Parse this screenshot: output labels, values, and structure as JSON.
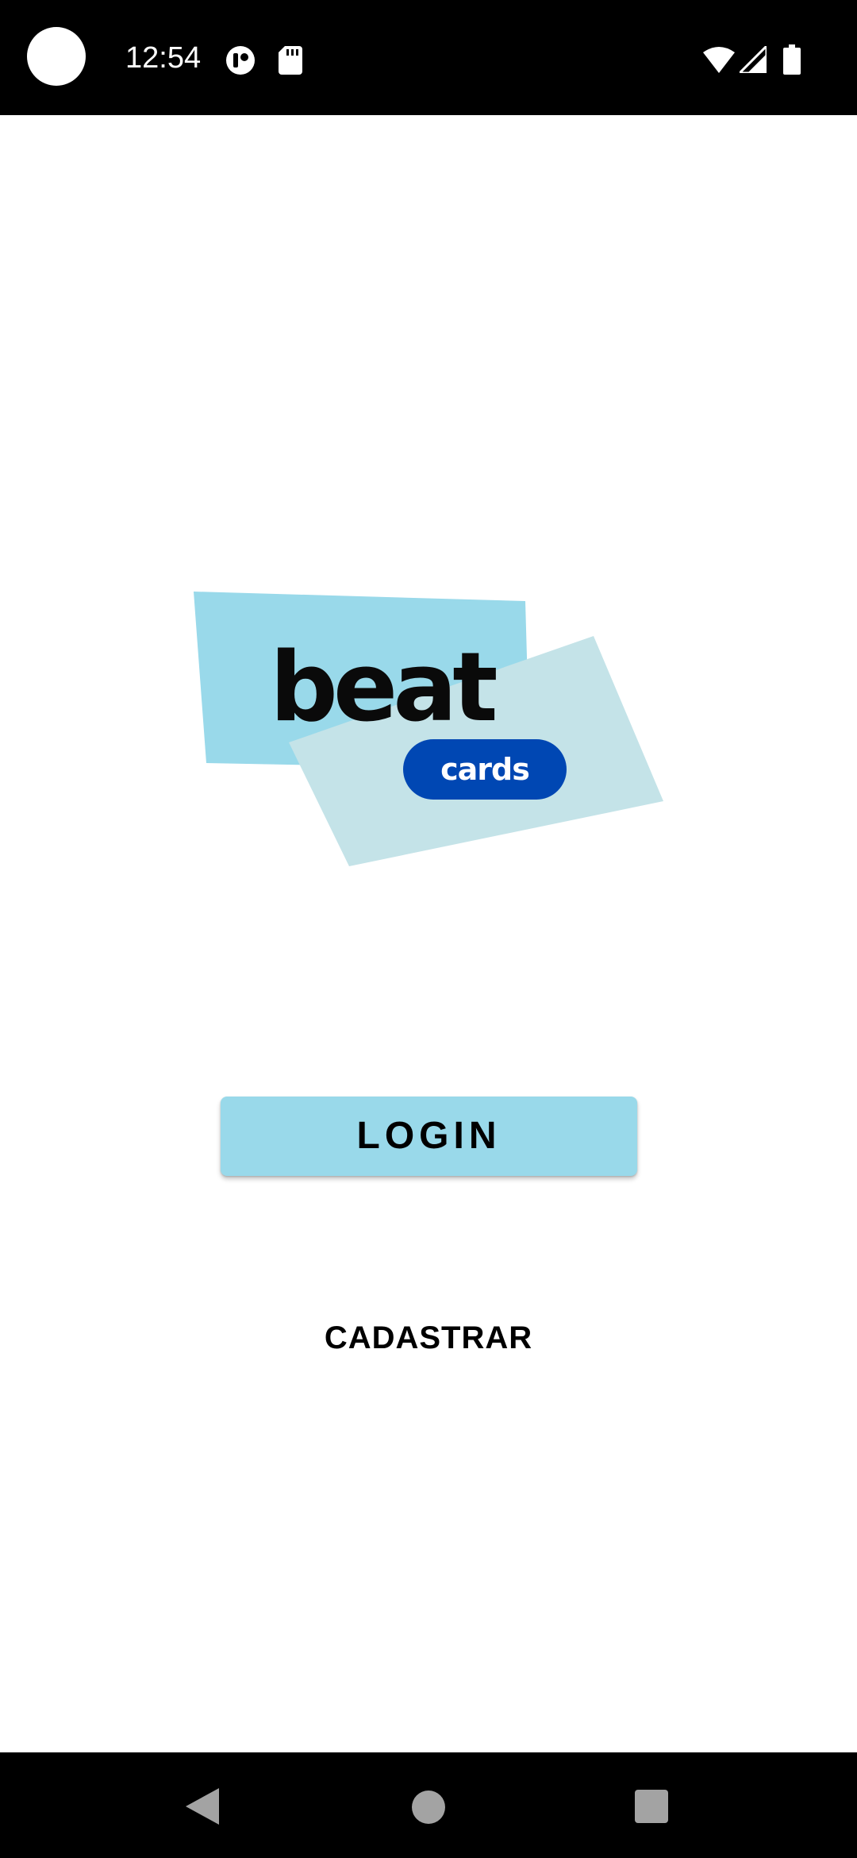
{
  "status_bar": {
    "time": "12:54",
    "icons": [
      "camera-cutout",
      "app-notification-icon",
      "sd-card-icon",
      "wifi-icon",
      "signal-icon",
      "battery-icon"
    ]
  },
  "logo": {
    "word": "beat",
    "pill": "cards",
    "colors": {
      "back_card": "#99d9ea",
      "front_card": "#c4e3e8",
      "pill": "#0047b3",
      "text": "#0a0a0a"
    }
  },
  "actions": {
    "login_label": "LOGIN",
    "register_label": "CADASTRAR"
  },
  "nav_bar": {
    "buttons": [
      "back-icon",
      "home-icon",
      "recents-icon"
    ]
  },
  "colors": {
    "accent": "#99d9ea",
    "background": "#ffffff"
  }
}
